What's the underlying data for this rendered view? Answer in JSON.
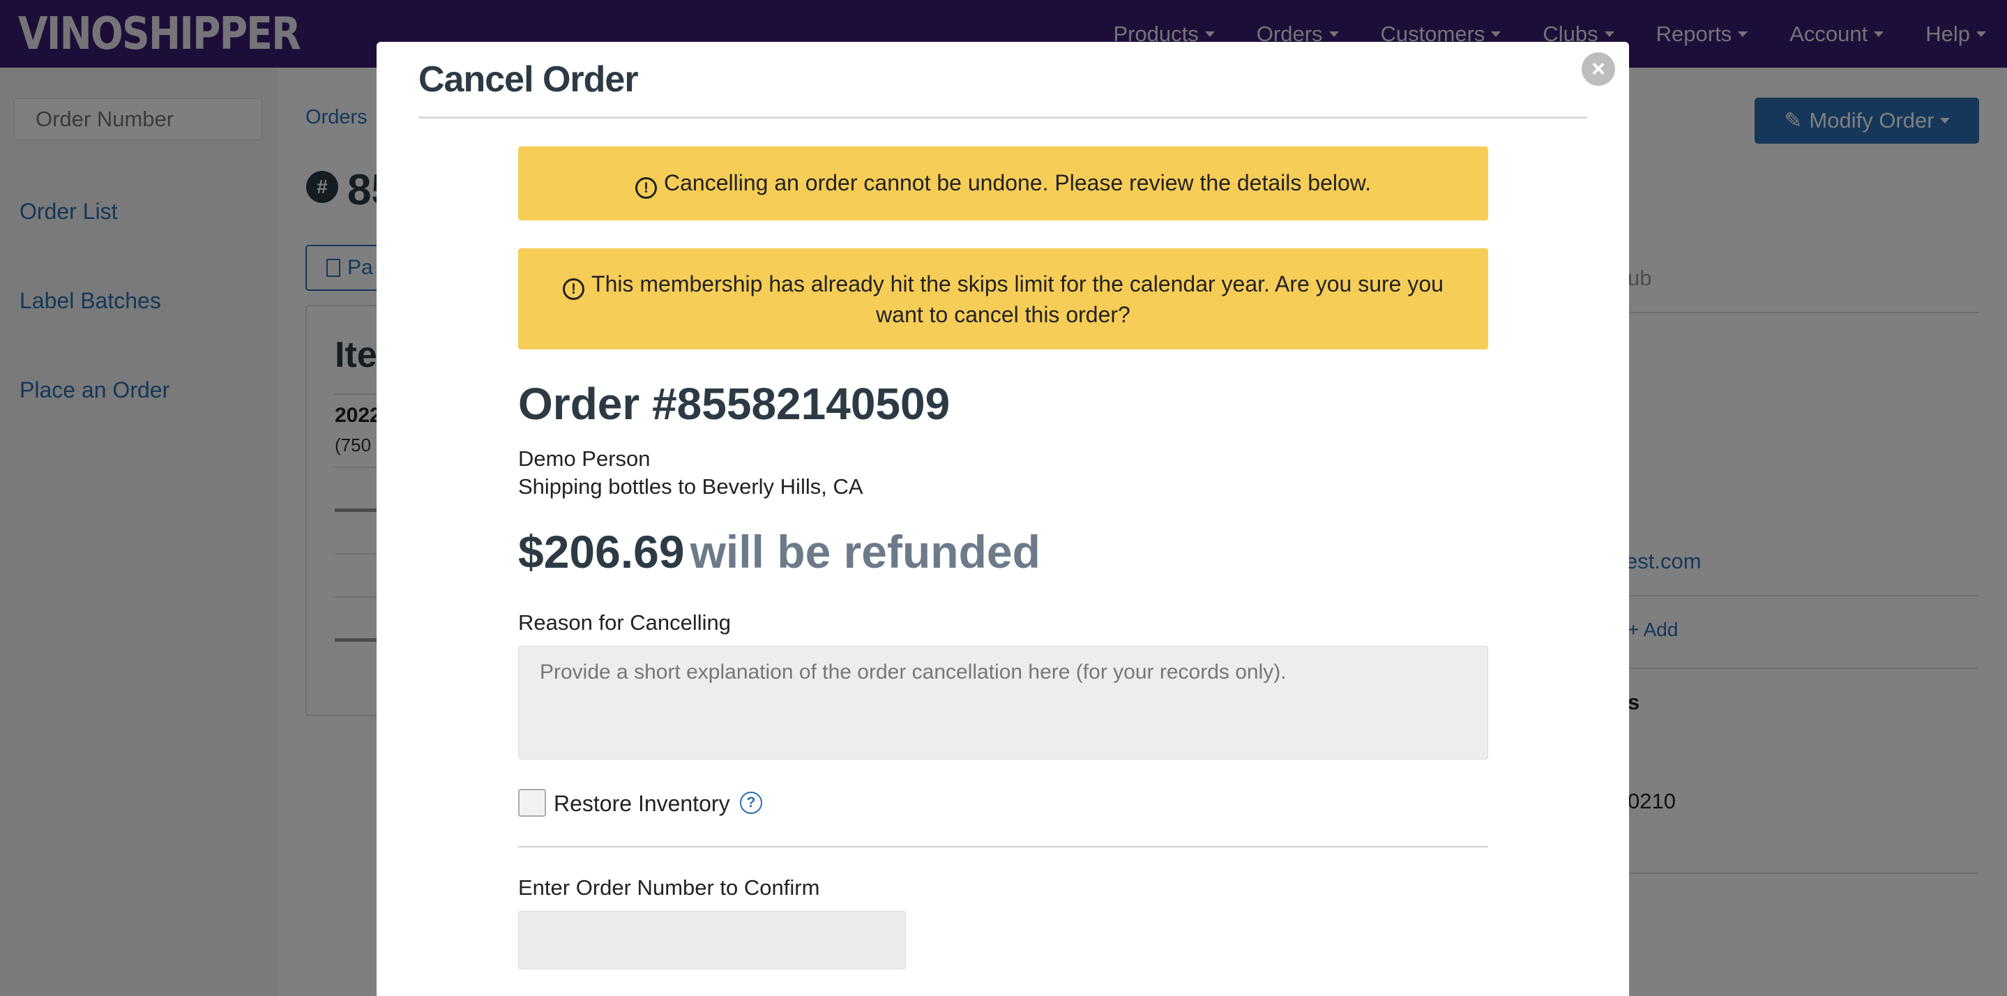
{
  "app": {
    "logo": "VINOSHIPPER",
    "nav": [
      {
        "label": "Products"
      },
      {
        "label": "Orders"
      },
      {
        "label": "Customers"
      },
      {
        "label": "Clubs"
      },
      {
        "label": "Reports"
      },
      {
        "label": "Account"
      },
      {
        "label": "Help"
      }
    ]
  },
  "sidebar": {
    "search_placeholder": "Order Number",
    "links": [
      "Order List",
      "Label Batches",
      "Place an Order"
    ]
  },
  "page": {
    "breadcrumb": "Orders",
    "hash_symbol": "#",
    "order_title_partial": "85",
    "pack_button_partial": "Pa",
    "items_title_partial": "Ite",
    "item_year_partial": "2022",
    "item_size_partial": "(750",
    "modify_button": "Modify Order",
    "right_fragments": {
      "club_partial": "ub",
      "dot": ".",
      "email_partial": "est.com",
      "add": "+ Add",
      "s_partial": "s",
      "number_partial": "0210"
    }
  },
  "modal": {
    "title": "Cancel Order",
    "close_symbol": "×",
    "alert_icon": "!",
    "alert_primary": "Cancelling an order cannot be undone. Please review the details below.",
    "alert_secondary": "This membership has already hit the skips limit for the calendar year. Are you sure you want to cancel this order?",
    "order_heading": "Order #85582140509",
    "customer_name": "Demo Person",
    "shipping_text": "Shipping bottles to Beverly Hills, CA",
    "refund_amount": "$206.69",
    "refund_text": "will be refunded",
    "reason_label": "Reason for Cancelling",
    "reason_placeholder": "Provide a short explanation of the order cancellation here (for your records only).",
    "restore_inventory_label": "Restore Inventory",
    "restore_inventory_checked": false,
    "help_symbol": "?",
    "confirm_label": "Enter Order Number to Confirm",
    "confirm_value": ""
  },
  "colors": {
    "nav_bg": "#3a1d72",
    "alert_bg": "#f6cd57",
    "link": "#2a6fb3",
    "heading": "#2d3a44",
    "refund_text": "#6c7a89"
  }
}
